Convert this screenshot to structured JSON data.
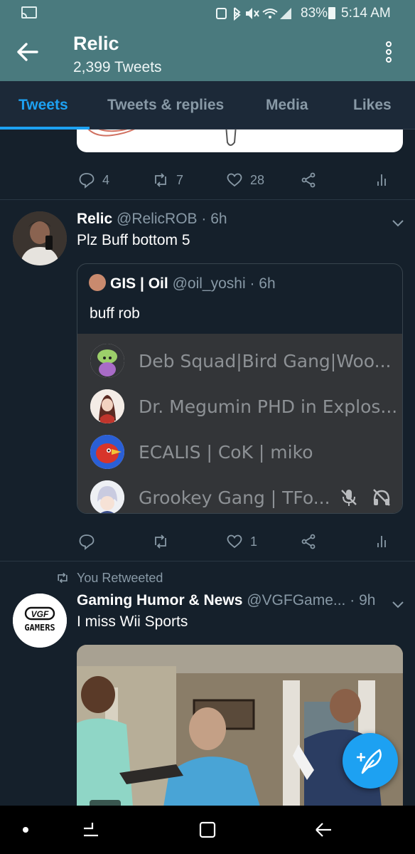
{
  "status_bar": {
    "battery": "83%",
    "time": "5:14 AM"
  },
  "header": {
    "title": "Relic",
    "tweet_count": "2,399 Tweets"
  },
  "tabs": [
    {
      "label": "Tweets",
      "active": true
    },
    {
      "label": "Tweets & replies",
      "active": false
    },
    {
      "label": "Media",
      "active": false
    },
    {
      "label": "Likes",
      "active": false
    }
  ],
  "tweets": [
    {
      "actions": {
        "replies": "4",
        "retweets": "7",
        "likes": "28"
      }
    },
    {
      "name": "Relic",
      "handle": "@RelicROB",
      "time": "· 6h",
      "text": "Plz Buff bottom 5",
      "quote": {
        "name": "GIS | Oil",
        "handle": "@oil_yoshi",
        "time": "· 6h",
        "text": "buff rob",
        "discord_members": [
          {
            "name": "Deb Squad|Bird Gang|Woo..."
          },
          {
            "name": "Dr. Megumin PHD in Explos..."
          },
          {
            "name": "ECALIS | CoK | miko"
          },
          {
            "name": "Grookey Gang | TFo..."
          }
        ]
      },
      "actions": {
        "replies": "",
        "retweets": "",
        "likes": "1"
      }
    },
    {
      "retweet_label": "You Retweeted",
      "name": "Gaming Humor & News",
      "handle": "@VGFGame...",
      "time": "· 9h",
      "text": "I miss Wii Sports",
      "avatar_text": "GAMERS",
      "avatar_logo": "VGF"
    }
  ],
  "colors": {
    "accent": "#1da1f2",
    "header_bg": "#4a7a7e",
    "background": "#15202b"
  }
}
